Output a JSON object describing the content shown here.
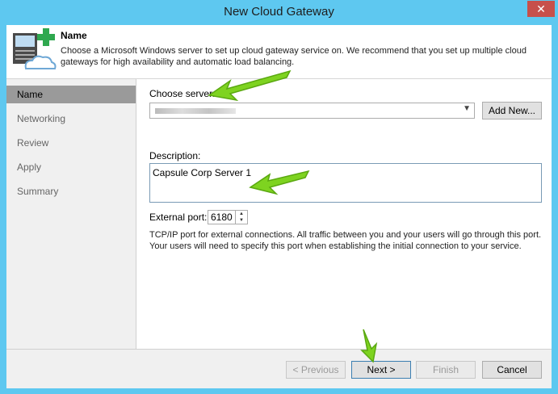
{
  "window": {
    "title": "New Cloud Gateway",
    "close_glyph": "✕"
  },
  "header": {
    "title": "Name",
    "description": "Choose a Microsoft Windows server to set up cloud gateway service on. We recommend that you set up multiple cloud gateways for high availability and automatic load balancing.",
    "icon": "server-cloud-add-icon"
  },
  "sidebar": {
    "items": [
      {
        "label": "Name",
        "active": true
      },
      {
        "label": "Networking",
        "active": false
      },
      {
        "label": "Review",
        "active": false
      },
      {
        "label": "Apply",
        "active": false
      },
      {
        "label": "Summary",
        "active": false
      }
    ]
  },
  "form": {
    "server_label": "Choose server:",
    "add_new_label": "Add New...",
    "description_label": "Description:",
    "description_value": "Capsule Corp Server 1",
    "port_label": "External port:",
    "port_value": "6180",
    "port_help": "TCP/IP port for external connections. All traffic between you and your users will go through this port. Your users will need to specify this port when establishing the initial connection to your service."
  },
  "footer": {
    "previous_label": "< Previous",
    "next_label": "Next >",
    "finish_label": "Finish",
    "cancel_label": "Cancel"
  },
  "colors": {
    "title_bar": "#5ec8f0",
    "close_button": "#c7504b",
    "annotation_arrow": "#7ed320"
  }
}
